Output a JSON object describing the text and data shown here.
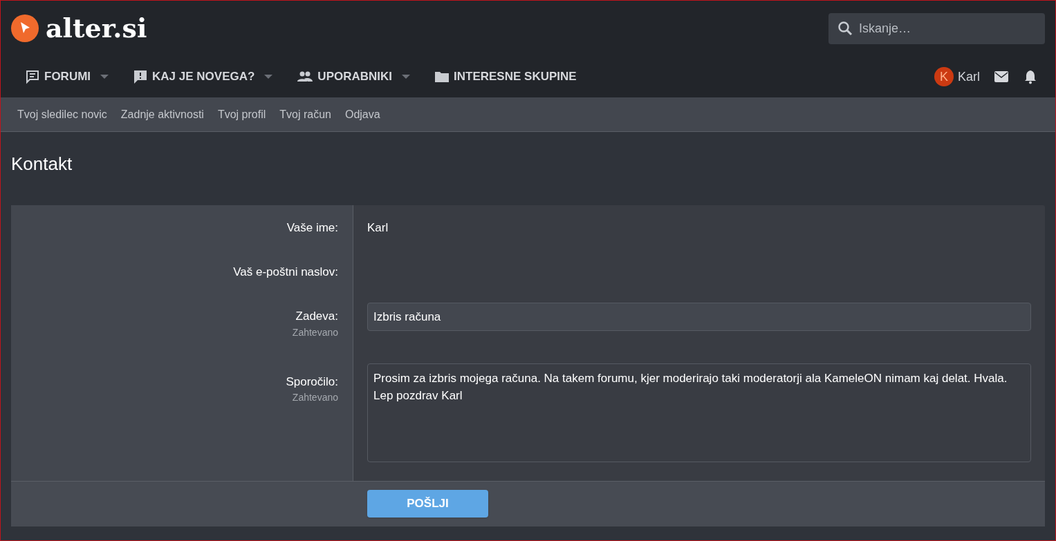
{
  "logo": {
    "text": "alter.si"
  },
  "search": {
    "placeholder": "Iskanje…"
  },
  "nav": [
    {
      "label": "FORUMI",
      "dropdown": true
    },
    {
      "label": "KAJ JE NOVEGA?",
      "dropdown": true
    },
    {
      "label": "UPORABNIKI",
      "dropdown": true
    },
    {
      "label": "INTERESNE SKUPINE",
      "dropdown": false
    }
  ],
  "user": {
    "initial": "K",
    "name": "Karl"
  },
  "subnav": [
    "Tvoj sledilec novic",
    "Zadnje aktivnosti",
    "Tvoj profil",
    "Tvoj račun",
    "Odjava"
  ],
  "page_title": "Kontakt",
  "form": {
    "fields": [
      {
        "kind": "static",
        "label": "Vaše ime:",
        "value": "Karl"
      },
      {
        "kind": "static",
        "label": "Vaš e-poštni naslov:"
      },
      {
        "kind": "text",
        "label": "Zadeva:",
        "hint": "Zahtevano",
        "value": "Izbris računa"
      },
      {
        "kind": "textarea",
        "label": "Sporočilo:",
        "hint": "Zahtevano",
        "value": "Prosim za izbris mojega računa. Na takem forumu, kjer moderirajo taki moderatorji ala KameleON nimam kaj delat. Hvala. Lep pozdrav Karl"
      }
    ],
    "submit": "POŠLJI"
  }
}
